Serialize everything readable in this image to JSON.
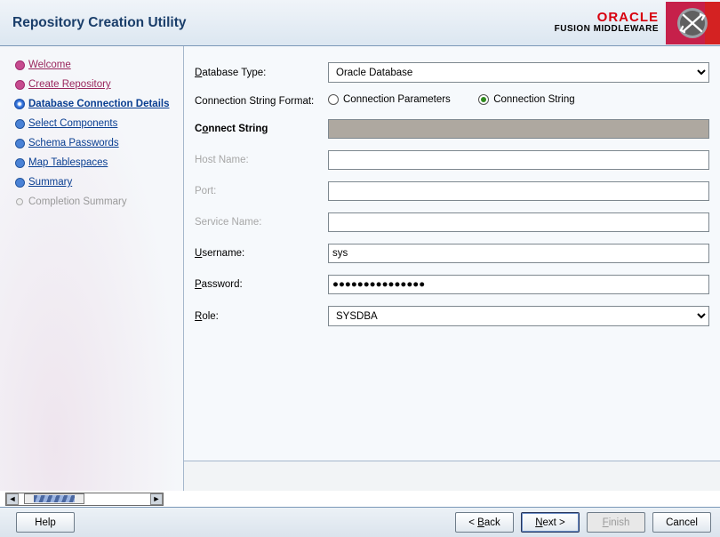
{
  "header": {
    "title": "Repository Creation Utility",
    "brand_name": "ORACLE",
    "brand_sub": "FUSION MIDDLEWARE"
  },
  "steps": [
    {
      "label": "Welcome",
      "state": "done"
    },
    {
      "label": "Create Repository",
      "state": "done"
    },
    {
      "label": "Database Connection Details",
      "state": "current"
    },
    {
      "label": "Select Components",
      "state": "pending"
    },
    {
      "label": "Schema Passwords",
      "state": "pending"
    },
    {
      "label": "Map Tablespaces",
      "state": "pending"
    },
    {
      "label": "Summary",
      "state": "pending"
    },
    {
      "label": "Completion Summary",
      "state": "disabled"
    }
  ],
  "form": {
    "db_type_label": "Database Type:",
    "db_type_value": "Oracle Database",
    "conn_fmt_label": "Connection String Format:",
    "conn_fmt_opt_params": "Connection Parameters",
    "conn_fmt_opt_string": "Connection String",
    "connect_string_label": "Connect String",
    "connect_string_value": "",
    "host_label": "Host Name:",
    "port_label": "Port:",
    "service_label": "Service Name:",
    "username_label": "Username:",
    "username_value": "sys",
    "password_label": "Password:",
    "password_mask": "●●●●●●●●●●●●●●●",
    "role_label": "Role:",
    "role_value": "SYSDBA"
  },
  "buttons": {
    "help": "Help",
    "back": "< Back",
    "next": "Next >",
    "finish": "Finish",
    "cancel": "Cancel"
  }
}
